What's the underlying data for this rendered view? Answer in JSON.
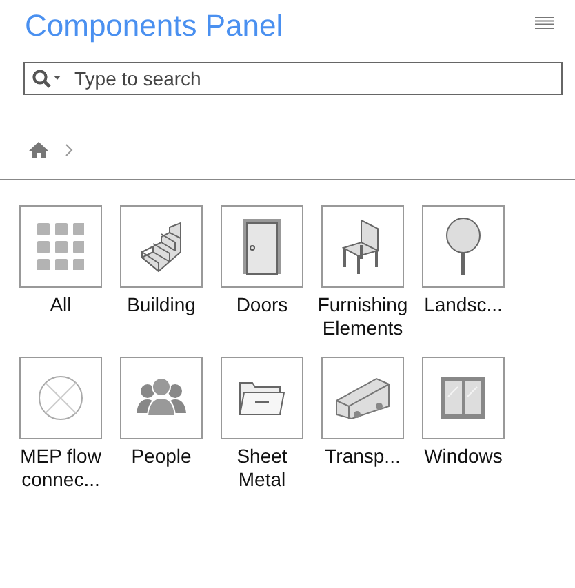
{
  "title": "Components Panel",
  "search": {
    "placeholder": "Type to search"
  },
  "categories": [
    {
      "label": "All",
      "kind": "all"
    },
    {
      "label": "Building",
      "kind": "stairs"
    },
    {
      "label": "Doors",
      "kind": "door"
    },
    {
      "label": "Furnishing Elements",
      "kind": "chair"
    },
    {
      "label": "Landsc...",
      "kind": "tree"
    },
    {
      "label": "MEP flow connec...",
      "kind": "flow"
    },
    {
      "label": "People",
      "kind": "people"
    },
    {
      "label": "Sheet Metal",
      "kind": "folder"
    },
    {
      "label": "Transp...",
      "kind": "bus"
    },
    {
      "label": "Windows",
      "kind": "window"
    }
  ]
}
